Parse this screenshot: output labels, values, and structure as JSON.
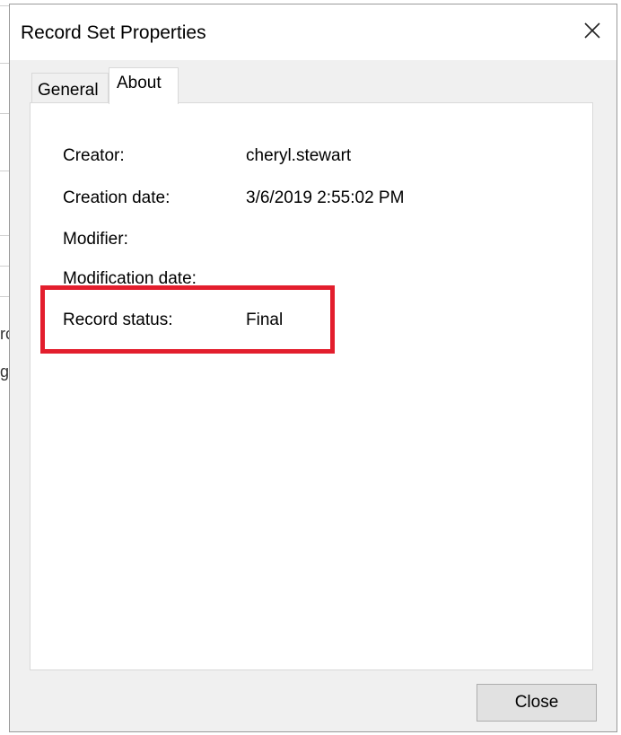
{
  "window": {
    "title": "Record Set Properties",
    "close_icon": "close-icon"
  },
  "background_fragments": [
    {
      "text": "rc"
    },
    {
      "text": "g"
    }
  ],
  "tabs": [
    {
      "label": "General",
      "active": false
    },
    {
      "label": "About",
      "active": true
    }
  ],
  "about": {
    "fields": [
      {
        "label": "Creator:",
        "value": "cheryl.stewart"
      },
      {
        "label": "Creation date:",
        "value": "3/6/2019 2:55:02 PM"
      },
      {
        "label": "Modifier:",
        "value": ""
      },
      {
        "label": "Modification date:",
        "value": ""
      },
      {
        "label": "Record status:",
        "value": "Final"
      }
    ],
    "highlight_color": "#e31e2d"
  },
  "footer": {
    "close_label": "Close"
  }
}
